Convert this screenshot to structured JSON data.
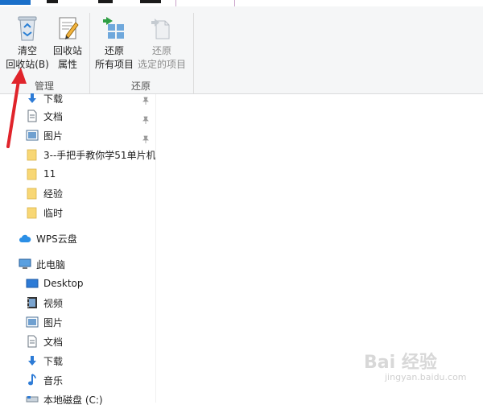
{
  "ribbon": {
    "manage": {
      "empty_recycle_line1": "清空",
      "empty_recycle_line2": "回收站(B)",
      "recycle_props_line1": "回收站",
      "recycle_props_line2": "属性",
      "group_label": "管理"
    },
    "restore": {
      "restore_all_line1": "还原",
      "restore_all_line2": "所有项目",
      "restore_selected_line1": "还原",
      "restore_selected_line2": "选定的项目",
      "group_label": "还原"
    }
  },
  "nav": {
    "quick_access": [
      {
        "label": "下载",
        "icon": "download-icon"
      },
      {
        "label": "文档",
        "icon": "document-icon"
      },
      {
        "label": "图片",
        "icon": "pictures-icon"
      },
      {
        "label": "3--手把手教你学51单片机",
        "icon": "folder-icon"
      },
      {
        "label": "11",
        "icon": "folder-icon"
      },
      {
        "label": "经验",
        "icon": "folder-icon"
      },
      {
        "label": "临时",
        "icon": "folder-icon"
      }
    ],
    "wps_cloud": "WPS云盘",
    "this_pc": "此电脑",
    "pc_items": [
      {
        "label": "Desktop",
        "icon": "desktop-icon"
      },
      {
        "label": "视频",
        "icon": "video-icon"
      },
      {
        "label": "图片",
        "icon": "pictures-icon"
      },
      {
        "label": "文档",
        "icon": "document-icon"
      },
      {
        "label": "下载",
        "icon": "download-icon"
      },
      {
        "label": "音乐",
        "icon": "music-icon"
      },
      {
        "label": "本地磁盘 (C:)",
        "icon": "drive-icon"
      }
    ]
  },
  "watermark": {
    "brand": "Bai 经验",
    "sub": "jingyan.baidu.com"
  },
  "colors": {
    "accent": "#1a6fc9",
    "annotation_arrow": "#e0242b",
    "folder": "#f8d775"
  }
}
